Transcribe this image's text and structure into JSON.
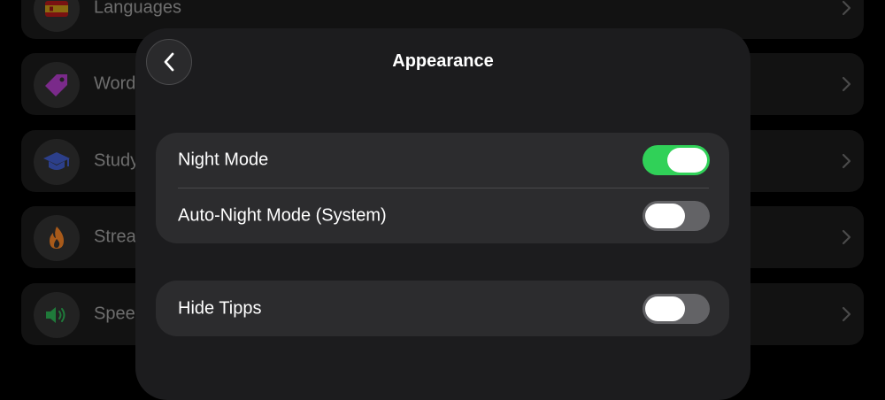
{
  "background_list": {
    "items": [
      {
        "label": "Languages",
        "icon": "spain-flag-icon"
      },
      {
        "label": "Word",
        "icon": "tag-icon"
      },
      {
        "label": "Study",
        "icon": "graduation-cap-icon"
      },
      {
        "label": "Strea",
        "icon": "flame-icon"
      },
      {
        "label": "Spee",
        "icon": "speaker-icon"
      }
    ]
  },
  "sheet": {
    "title": "Appearance",
    "back_icon": "chevron-left-icon",
    "groups": [
      {
        "rows": [
          {
            "label": "Night Mode",
            "toggle_on": true
          },
          {
            "label": "Auto-Night Mode (System)",
            "toggle_on": false
          }
        ]
      },
      {
        "rows": [
          {
            "label": "Hide Tipps",
            "toggle_on": false
          }
        ]
      }
    ]
  },
  "colors": {
    "toggle_on": "#30d158",
    "toggle_off": "#636366",
    "sheet_bg": "#1c1c1e",
    "group_bg": "#2c2c2e"
  }
}
